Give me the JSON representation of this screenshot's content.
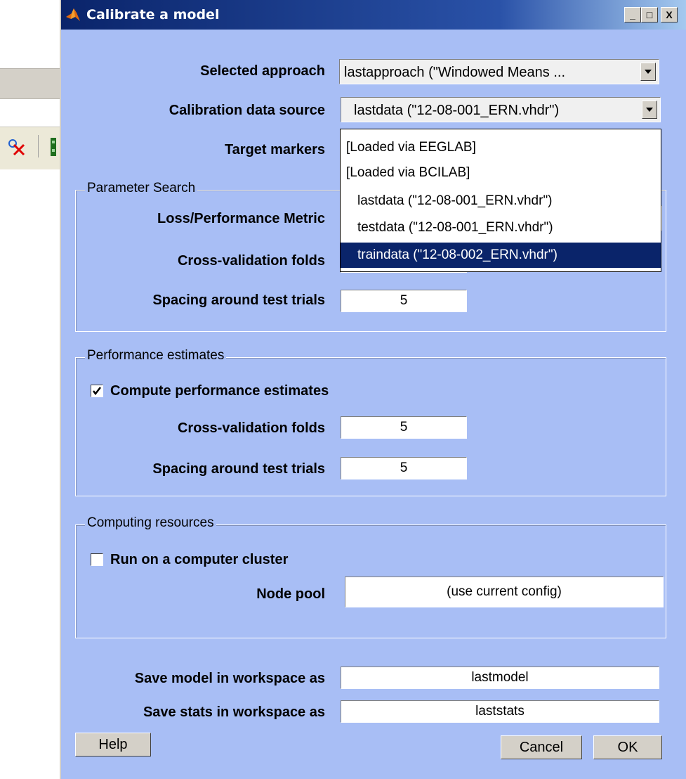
{
  "window": {
    "title": "Calibrate a model",
    "minimize_glyph": "_",
    "maximize_glyph": "□",
    "close_glyph": "X"
  },
  "fields": {
    "selected_approach_label": "Selected approach",
    "selected_approach_value": "lastapproach (\"Windowed Means ...",
    "calibration_source_label": "Calibration data source",
    "calibration_source_value": "lastdata (\"12-08-001_ERN.vhdr\")",
    "target_markers_label": "Target markers"
  },
  "dropdown": {
    "items": [
      "[Loaded via EEGLAB]",
      "[Loaded via BCILAB]",
      "lastdata (\"12-08-001_ERN.vhdr\")",
      "testdata (\"12-08-001_ERN.vhdr\")",
      "traindata (\"12-08-002_ERN.vhdr\")"
    ],
    "highlighted_index": 4
  },
  "parameter_search": {
    "title": "Parameter Search",
    "metric_label": "Loss/Performance Metric",
    "folds_label": "Cross-validation folds",
    "spacing_label": "Spacing around test trials",
    "spacing_value": "5"
  },
  "performance": {
    "title": "Performance estimates",
    "compute_label": "Compute performance estimates",
    "compute_checked": true,
    "folds_label": "Cross-validation folds",
    "folds_value": "5",
    "spacing_label": "Spacing around test trials",
    "spacing_value": "5"
  },
  "computing": {
    "title": "Computing resources",
    "cluster_label": "Run on a computer cluster",
    "cluster_checked": false,
    "node_pool_label": "Node pool",
    "node_pool_value": "(use current config)"
  },
  "workspace": {
    "model_label": "Save model in workspace as",
    "model_value": "lastmodel",
    "stats_label": "Save stats in workspace as",
    "stats_value": "laststats"
  },
  "buttons": {
    "help": "Help",
    "cancel": "Cancel",
    "ok": "OK"
  },
  "colors": {
    "dialog_bg": "#a8bef5",
    "title_bar": "#0a246a",
    "selection": "#0a246a"
  }
}
